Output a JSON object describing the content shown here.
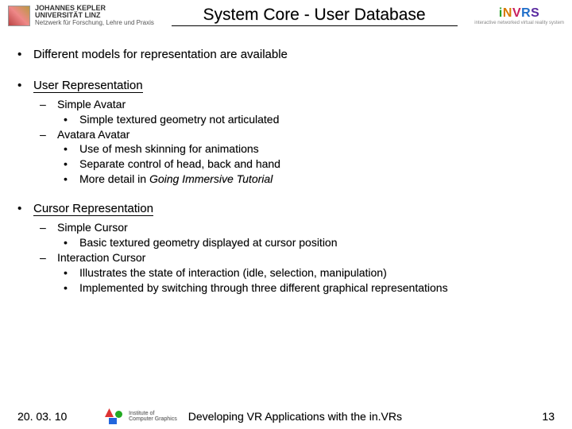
{
  "header": {
    "left_logo": {
      "line1": "JOHANNES KEPLER",
      "line2": "UNIVERSITÄT LINZ",
      "line3": "Netzwerk für Forschung, Lehre und Praxis"
    },
    "title": "System Core - User Database",
    "right_logo": {
      "text": "iNVRS",
      "sub": "interactive networked virtual reality system"
    }
  },
  "bullets": [
    {
      "text": "Different models for representation are available"
    },
    {
      "text": "User Representation",
      "underline": true,
      "children": [
        {
          "text": "Simple Avatar",
          "children": [
            {
              "text": "Simple textured geometry not articulated"
            }
          ]
        },
        {
          "text": "Avatara Avatar",
          "children": [
            {
              "text": "Use of mesh skinning for animations"
            },
            {
              "text": "Separate control of head, back and hand"
            },
            {
              "text_html": "More detail in <em>Going Immersive Tutorial</em>"
            }
          ]
        }
      ]
    },
    {
      "text": "Cursor Representation",
      "underline": true,
      "children": [
        {
          "text": "Simple Cursor",
          "children": [
            {
              "text": "Basic textured geometry displayed at cursor position"
            }
          ]
        },
        {
          "text": "Interaction Cursor",
          "children": [
            {
              "text": "Illustrates the state of interaction (idle, selection, manipulation)"
            },
            {
              "text": "Implemented by switching through three different graphical representations"
            }
          ]
        }
      ]
    }
  ],
  "footer": {
    "date": "20. 03. 10",
    "inst": "Institute of\nComputer Graphics",
    "center": "Developing VR Applications with the in.VRs",
    "page": "13"
  }
}
